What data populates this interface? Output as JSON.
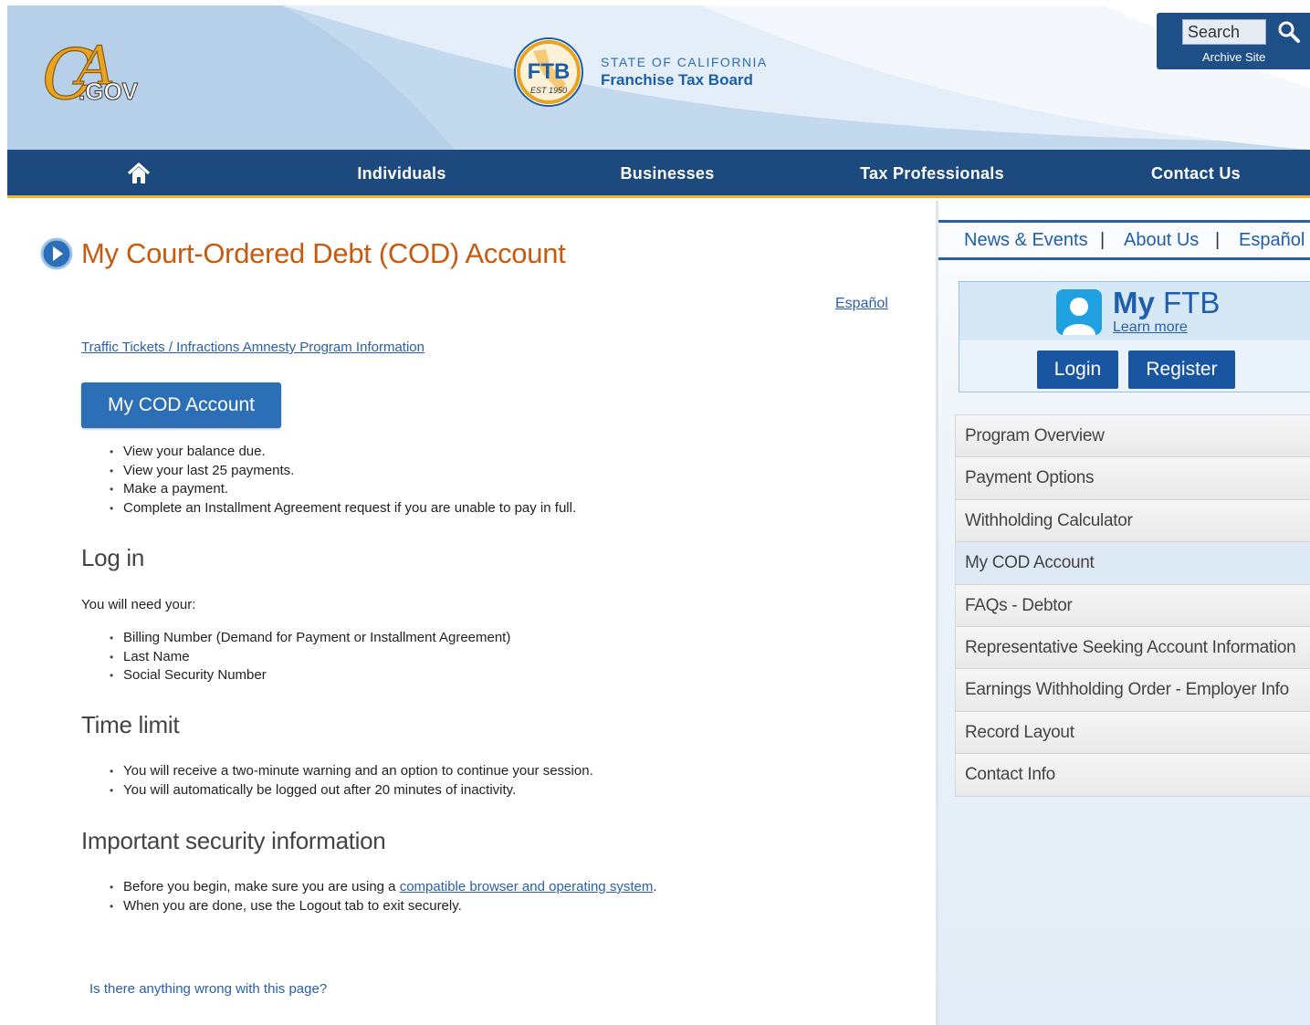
{
  "header": {
    "logo_text": "CA.GOV",
    "agency_state": "STATE OF CALIFORNIA",
    "agency_name": "Franchise Tax Board",
    "seal_text": "FTB",
    "seal_est": "EST 1950",
    "search_placeholder": "Search",
    "archive_label": "Archive Site"
  },
  "nav": {
    "items": [
      "Individuals",
      "Businesses",
      "Tax Professionals",
      "Contact Us"
    ]
  },
  "main": {
    "title": "My Court-Ordered Debt (COD) Account",
    "espanol_link": "Español",
    "traffic_link": "Traffic Tickets / Infractions Amnesty Program Information",
    "cod_button": "My COD Account",
    "features": [
      "View your balance due.",
      "View your last 25 payments.",
      "Make a payment.",
      "Complete an Installment Agreement request if you are unable to pay in full."
    ],
    "login_heading": "Log in",
    "need_text": "You will need your:",
    "needs": [
      "Billing Number (Demand for Payment or Installment Agreement)",
      "Last Name",
      "Social Security Number"
    ],
    "time_heading": "Time limit",
    "time_items": [
      "You will receive a two-minute warning and an option to continue your session.",
      "You will automatically be logged out after 20 minutes of inactivity."
    ],
    "security_heading": "Important security information",
    "security_1_pre": "Before you begin, make sure you are using a ",
    "security_1_link": "compatible browser and operating system",
    "security_1_post": ".",
    "security_2": "When you are done, use the Logout tab to exit securely.",
    "feedback_link": "Is there anything wrong with this page?"
  },
  "sidebar": {
    "top_links": [
      "News & Events",
      "About Us",
      "Español"
    ],
    "separator": "|",
    "myftb_my": "My",
    "myftb_ftb": "FTB",
    "learn_more": "Learn more",
    "login": "Login",
    "register": "Register",
    "menu": [
      "Program Overview",
      "Payment Options",
      "Withholding Calculator",
      "My COD Account",
      "FAQs - Debtor",
      "Representative Seeking Account Information",
      "Earnings Withholding Order - Employer Info",
      "Record Layout",
      "Contact Info"
    ],
    "active_index": 3
  },
  "colors": {
    "nav_bg": "#1c4a7f",
    "nav_underline": "#f0b43c",
    "title": "#c65a0e",
    "link": "#2a5fa8",
    "button": "#2d6fb6"
  }
}
